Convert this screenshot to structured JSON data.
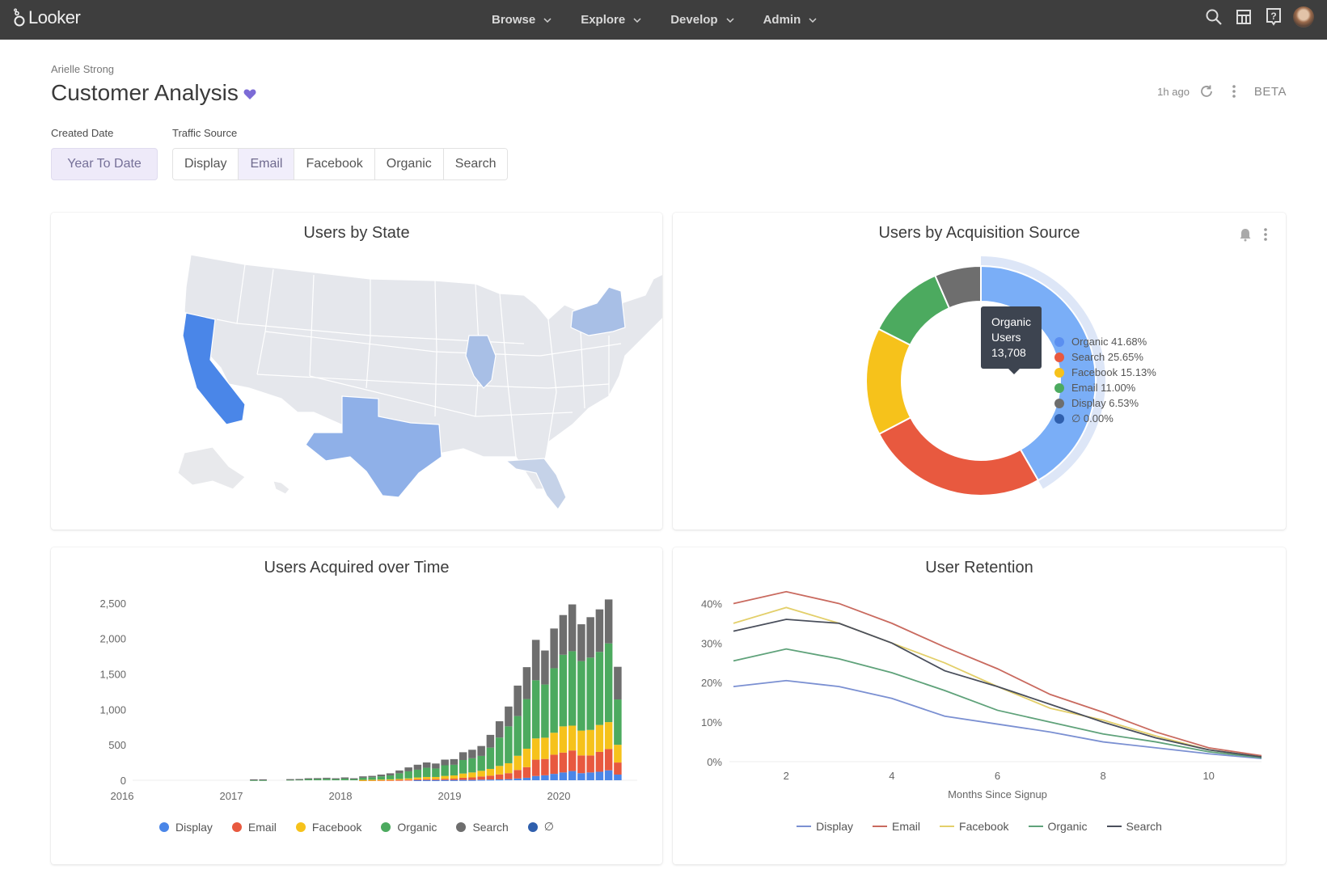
{
  "app": {
    "name": "Looker",
    "nav": [
      {
        "label": "Browse"
      },
      {
        "label": "Explore"
      },
      {
        "label": "Develop"
      },
      {
        "label": "Admin"
      }
    ],
    "icons": [
      "search-icon",
      "marketplace-icon",
      "help-icon",
      "user-avatar"
    ]
  },
  "dashboard": {
    "owner": "Arielle Strong",
    "title": "Customer Analysis",
    "favorite": true,
    "updated": "1h ago",
    "badge": "BETA"
  },
  "filters": {
    "created_date": {
      "label": "Created Date",
      "value": "Year To Date"
    },
    "traffic_source": {
      "label": "Traffic Source",
      "options": [
        "Display",
        "Email",
        "Facebook",
        "Organic",
        "Search"
      ],
      "selected": "Email"
    }
  },
  "colors": {
    "Display": "#4a86e8",
    "Email": "#e8593f",
    "Facebook": "#f6c21b",
    "Organic": "#4caa5f",
    "Search": "#6e6e6e",
    "Null": "#2f5fad",
    "OrganicDonut": "#7aaef7",
    "accent": "#7c6bd6"
  },
  "chart_data": [
    {
      "type": "map",
      "title": "Users by State",
      "highlighted_states": [
        {
          "state": "California",
          "intensity": "high"
        },
        {
          "state": "Texas",
          "intensity": "medium"
        },
        {
          "state": "New York",
          "intensity": "low-medium"
        },
        {
          "state": "Illinois",
          "intensity": "low-medium"
        },
        {
          "state": "Florida",
          "intensity": "low"
        }
      ]
    },
    {
      "type": "pie",
      "title": "Users by Acquisition Source",
      "donut": true,
      "slices": [
        {
          "name": "Organic",
          "percent": 41.68,
          "label": "Organic 41.68%"
        },
        {
          "name": "Search",
          "percent": 25.65,
          "label": "Search 25.65%"
        },
        {
          "name": "Facebook",
          "percent": 15.13,
          "label": "Facebook 15.13%"
        },
        {
          "name": "Email",
          "percent": 11.0,
          "label": "Email 11.00%"
        },
        {
          "name": "Display",
          "percent": 6.53,
          "label": "Display 6.53%"
        },
        {
          "name": "∅",
          "percent": 0.0,
          "label": "∅ 0.00%"
        }
      ],
      "tooltip": {
        "line1": "Organic",
        "line2": "Users",
        "line3": "13,708"
      },
      "legend": "right"
    },
    {
      "type": "bar",
      "stacked": true,
      "title": "Users Acquired over Time",
      "xlabel": "",
      "ylabel": "",
      "ylim": [
        0,
        2600
      ],
      "yticks": [
        "0",
        "500",
        "1,000",
        "1,500",
        "2,000",
        "2,500"
      ],
      "ytick_values": [
        0,
        500,
        1000,
        1500,
        2000,
        2500
      ],
      "xticks": [
        "2016",
        "2017",
        "2018",
        "2019",
        "2020"
      ],
      "x_start_year": 2016,
      "legend": "bottom",
      "legend_labels": [
        "Display",
        "Email",
        "Facebook",
        "Organic",
        "Search",
        "∅"
      ],
      "bars": [
        {
          "period": "2017-03",
          "totals": {
            "Display": 0,
            "Email": 0,
            "Facebook": 0,
            "Organic": 5,
            "Search": 8
          }
        },
        {
          "period": "2017-04",
          "totals": {
            "Display": 0,
            "Email": 0,
            "Facebook": 0,
            "Organic": 5,
            "Search": 8
          }
        },
        {
          "period": "2017-07",
          "totals": {
            "Display": 0,
            "Email": 0,
            "Facebook": 0,
            "Organic": 10,
            "Search": 6
          }
        },
        {
          "period": "2017-08",
          "totals": {
            "Display": 0,
            "Email": 0,
            "Facebook": 0,
            "Organic": 12,
            "Search": 6
          }
        },
        {
          "period": "2017-09",
          "totals": {
            "Display": 0,
            "Email": 0,
            "Facebook": 0,
            "Organic": 18,
            "Search": 10
          }
        },
        {
          "period": "2017-10",
          "totals": {
            "Display": 0,
            "Email": 0,
            "Facebook": 0,
            "Organic": 18,
            "Search": 12
          }
        },
        {
          "period": "2017-11",
          "totals": {
            "Display": 0,
            "Email": 0,
            "Facebook": 0,
            "Organic": 20,
            "Search": 15
          }
        },
        {
          "period": "2017-12",
          "totals": {
            "Display": 0,
            "Email": 0,
            "Facebook": 0,
            "Organic": 18,
            "Search": 10
          }
        },
        {
          "period": "2018-01",
          "totals": {
            "Display": 0,
            "Email": 0,
            "Facebook": 0,
            "Organic": 22,
            "Search": 18
          }
        },
        {
          "period": "2018-02",
          "totals": {
            "Display": 0,
            "Email": 0,
            "Facebook": 0,
            "Organic": 18,
            "Search": 10
          }
        },
        {
          "period": "2018-03",
          "totals": {
            "Display": 0,
            "Email": 2,
            "Facebook": 3,
            "Organic": 30,
            "Search": 20
          }
        },
        {
          "period": "2018-04",
          "totals": {
            "Display": 0,
            "Email": 3,
            "Facebook": 4,
            "Organic": 35,
            "Search": 20
          }
        },
        {
          "period": "2018-05",
          "totals": {
            "Display": 0,
            "Email": 4,
            "Facebook": 6,
            "Organic": 45,
            "Search": 25
          }
        },
        {
          "period": "2018-06",
          "totals": {
            "Display": 0,
            "Email": 5,
            "Facebook": 8,
            "Organic": 55,
            "Search": 30
          }
        },
        {
          "period": "2018-07",
          "totals": {
            "Display": 0,
            "Email": 6,
            "Facebook": 12,
            "Organic": 80,
            "Search": 40
          }
        },
        {
          "period": "2018-08",
          "totals": {
            "Display": 0,
            "Email": 8,
            "Facebook": 18,
            "Organic": 100,
            "Search": 55
          }
        },
        {
          "period": "2018-09",
          "totals": {
            "Display": 2,
            "Email": 12,
            "Facebook": 25,
            "Organic": 110,
            "Search": 70
          }
        },
        {
          "period": "2018-10",
          "totals": {
            "Display": 2,
            "Email": 14,
            "Facebook": 30,
            "Organic": 130,
            "Search": 75
          }
        },
        {
          "period": "2018-11",
          "totals": {
            "Display": 2,
            "Email": 14,
            "Facebook": 30,
            "Organic": 120,
            "Search": 70
          }
        },
        {
          "period": "2018-12",
          "totals": {
            "Display": 3,
            "Email": 18,
            "Facebook": 40,
            "Organic": 150,
            "Search": 80
          }
        },
        {
          "period": "2019-01",
          "totals": {
            "Display": 3,
            "Email": 20,
            "Facebook": 45,
            "Organic": 150,
            "Search": 80
          }
        },
        {
          "period": "2019-02",
          "totals": {
            "Display": 5,
            "Email": 30,
            "Facebook": 60,
            "Organic": 190,
            "Search": 110
          }
        },
        {
          "period": "2019-03",
          "totals": {
            "Display": 5,
            "Email": 35,
            "Facebook": 70,
            "Organic": 200,
            "Search": 120
          }
        },
        {
          "period": "2019-04",
          "totals": {
            "Display": 8,
            "Email": 45,
            "Facebook": 80,
            "Organic": 210,
            "Search": 140
          }
        },
        {
          "period": "2019-05",
          "totals": {
            "Display": 10,
            "Email": 55,
            "Facebook": 95,
            "Organic": 300,
            "Search": 180
          }
        },
        {
          "period": "2019-06",
          "totals": {
            "Display": 12,
            "Email": 70,
            "Facebook": 120,
            "Organic": 400,
            "Search": 230
          }
        },
        {
          "period": "2019-07",
          "totals": {
            "Display": 15,
            "Email": 85,
            "Facebook": 140,
            "Organic": 520,
            "Search": 280
          }
        },
        {
          "period": "2019-08",
          "totals": {
            "Display": 25,
            "Email": 120,
            "Facebook": 200,
            "Organic": 560,
            "Search": 430
          }
        },
        {
          "period": "2019-09",
          "totals": {
            "Display": 35,
            "Email": 150,
            "Facebook": 260,
            "Organic": 700,
            "Search": 450
          }
        },
        {
          "period": "2019-10",
          "totals": {
            "Display": 60,
            "Email": 230,
            "Facebook": 300,
            "Organic": 820,
            "Search": 570
          }
        },
        {
          "period": "2019-11",
          "totals": {
            "Display": 70,
            "Email": 230,
            "Facebook": 300,
            "Organic": 750,
            "Search": 480
          }
        },
        {
          "period": "2019-12",
          "totals": {
            "Display": 90,
            "Email": 270,
            "Facebook": 310,
            "Organic": 910,
            "Search": 560
          }
        },
        {
          "period": "2020-01",
          "totals": {
            "Display": 110,
            "Email": 280,
            "Facebook": 370,
            "Organic": 1010,
            "Search": 560
          }
        },
        {
          "period": "2020-02",
          "totals": {
            "Display": 130,
            "Email": 290,
            "Facebook": 350,
            "Organic": 1050,
            "Search": 660
          }
        },
        {
          "period": "2020-03",
          "totals": {
            "Display": 100,
            "Email": 250,
            "Facebook": 350,
            "Organic": 980,
            "Search": 520
          }
        },
        {
          "period": "2020-04",
          "totals": {
            "Display": 110,
            "Email": 240,
            "Facebook": 360,
            "Organic": 1020,
            "Search": 570
          }
        },
        {
          "period": "2020-05",
          "totals": {
            "Display": 120,
            "Email": 280,
            "Facebook": 380,
            "Organic": 1030,
            "Search": 600
          }
        },
        {
          "period": "2020-06",
          "totals": {
            "Display": 140,
            "Email": 300,
            "Facebook": 380,
            "Organic": 1110,
            "Search": 620
          }
        },
        {
          "period": "2020-07",
          "totals": {
            "Display": 80,
            "Email": 170,
            "Facebook": 250,
            "Organic": 640,
            "Search": 460
          }
        }
      ]
    },
    {
      "type": "line",
      "title": "User Retention",
      "xlabel": "Months Since Signup",
      "ylabel": "",
      "xlim": [
        1,
        11
      ],
      "ylim": [
        0,
        0.45
      ],
      "xticks": [
        2,
        4,
        6,
        8,
        10
      ],
      "yticks": [
        "0%",
        "10%",
        "20%",
        "30%",
        "40%"
      ],
      "ytick_values": [
        0,
        0.1,
        0.2,
        0.3,
        0.4
      ],
      "legend": "bottom",
      "x": [
        1,
        2,
        3,
        4,
        5,
        6,
        7,
        8,
        9,
        10,
        11
      ],
      "series": [
        {
          "name": "Display",
          "color": "#7b90d2",
          "values": [
            0.19,
            0.205,
            0.19,
            0.16,
            0.115,
            0.095,
            0.075,
            0.05,
            0.035,
            0.02,
            0.008
          ]
        },
        {
          "name": "Email",
          "color": "#c96a5f",
          "values": [
            0.4,
            0.43,
            0.4,
            0.35,
            0.29,
            0.235,
            0.17,
            0.125,
            0.075,
            0.035,
            0.015
          ]
        },
        {
          "name": "Facebook",
          "color": "#e3cf6a",
          "values": [
            0.35,
            0.39,
            0.35,
            0.3,
            0.25,
            0.19,
            0.135,
            0.105,
            0.065,
            0.03,
            0.012
          ]
        },
        {
          "name": "Organic",
          "color": "#5fa27a",
          "values": [
            0.255,
            0.285,
            0.26,
            0.225,
            0.18,
            0.13,
            0.1,
            0.07,
            0.05,
            0.025,
            0.01
          ]
        },
        {
          "name": "Search",
          "color": "#4a4f5c",
          "values": [
            0.33,
            0.36,
            0.35,
            0.3,
            0.23,
            0.19,
            0.145,
            0.1,
            0.06,
            0.03,
            0.012
          ]
        }
      ]
    }
  ]
}
